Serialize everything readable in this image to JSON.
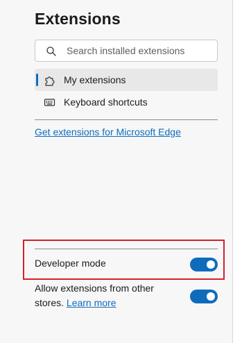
{
  "sidebar": {
    "title": "Extensions",
    "search": {
      "placeholder": "Search installed extensions",
      "value": ""
    },
    "items": [
      {
        "label": "My extensions",
        "icon": "puzzle-icon",
        "active": true
      },
      {
        "label": "Keyboard shortcuts",
        "icon": "keyboard-icon",
        "active": false
      }
    ],
    "get_extensions_link": "Get extensions for Microsoft Edge"
  },
  "settings": {
    "developer_mode": {
      "label": "Developer mode",
      "enabled": true
    },
    "allow_other_stores": {
      "label_line1": "Allow extensions from other",
      "label_line2": "stores.",
      "learn_more": "Learn more",
      "enabled": true
    }
  },
  "colors": {
    "accent": "#0f6cbd",
    "highlight_border": "#d4202c",
    "panel_bg": "#f7f7f7"
  }
}
